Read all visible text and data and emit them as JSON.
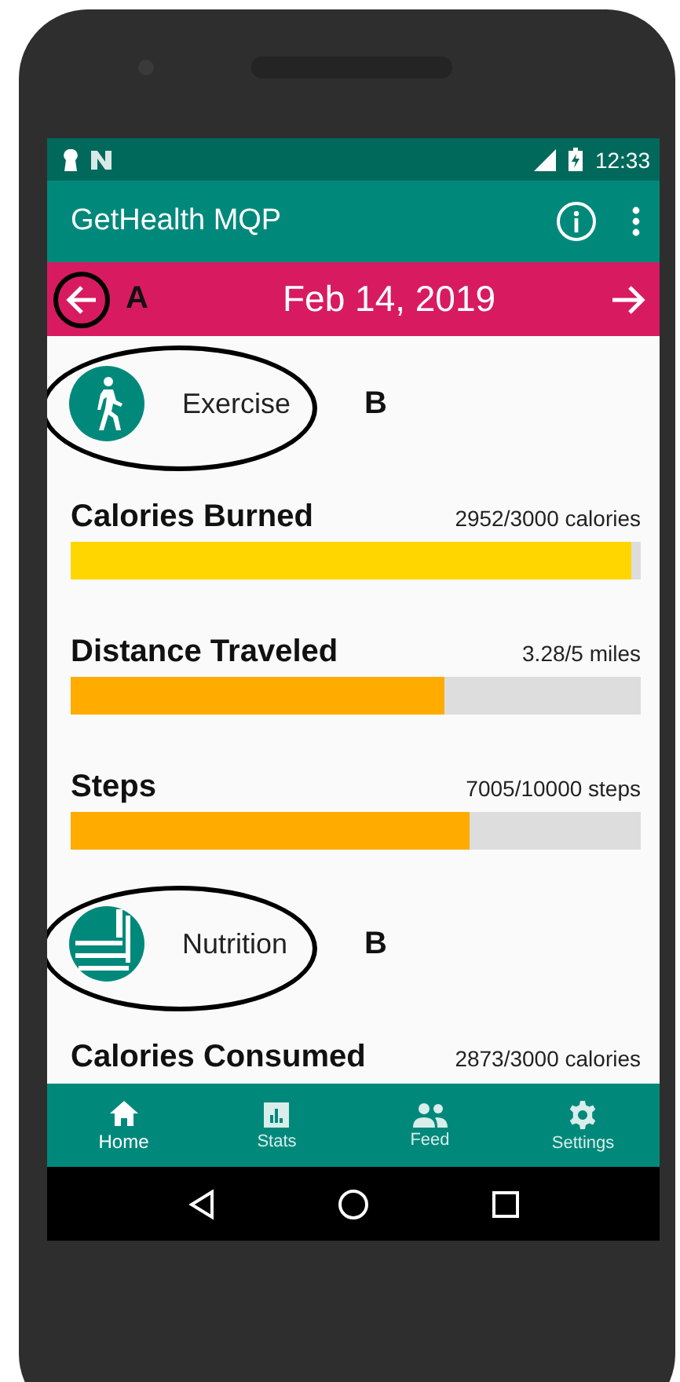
{
  "status_bar": {
    "time": "12:33"
  },
  "app_bar": {
    "title": "GetHealth MQP"
  },
  "date_bar": {
    "date": "Feb 14, 2019",
    "back_marker": "A"
  },
  "sections": [
    {
      "kind": "exercise",
      "title": "Exercise",
      "marker": "B",
      "stats": [
        {
          "name": "Calories Burned",
          "reading": "2952/3000 calories",
          "level": 0.984,
          "color": "#ffd600"
        },
        {
          "name": "Distance Traveled",
          "reading": "3.28/5 miles",
          "level": 0.656,
          "color": "#ffab00"
        },
        {
          "name": "Steps",
          "reading": "7005/10000 steps",
          "level": 0.7005,
          "color": "#ffab00"
        }
      ]
    },
    {
      "kind": "nutrition",
      "title": "Nutrition",
      "marker": "B",
      "stats": [
        {
          "name": "Calories Consumed",
          "reading": "2873/3000 calories"
        }
      ]
    }
  ],
  "bottom_nav": [
    {
      "kind": "home",
      "label": "Home",
      "selected": true
    },
    {
      "kind": "stats",
      "label": "Stats",
      "selected": false
    },
    {
      "kind": "feed",
      "label": "Feed",
      "selected": false
    },
    {
      "kind": "settings",
      "label": "Settings",
      "selected": false
    }
  ]
}
